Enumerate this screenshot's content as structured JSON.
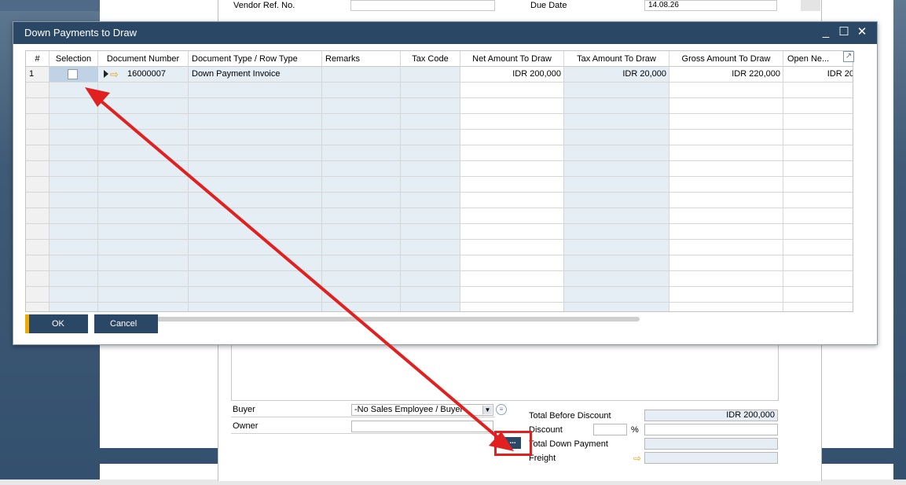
{
  "background_form": {
    "vendor_ref_label": "Vendor Ref. No.",
    "vendor_ref_value": "",
    "due_date_label": "Due Date",
    "due_date_value": "14.08.26",
    "buyer_label": "Buyer",
    "buyer_value": "-No Sales Employee / Buyer-",
    "owner_label": "Owner",
    "owner_value": "",
    "totals": {
      "total_before_discount_label": "Total Before Discount",
      "total_before_discount_value": "IDR 200,000",
      "discount_label": "Discount",
      "discount_pct_value": "",
      "discount_pct_unit": "%",
      "discount_value": "",
      "total_down_payment_label": "Total Down Payment",
      "total_down_payment_value": "",
      "freight_label": "Freight",
      "freight_value": "",
      "dots_button_label": "..."
    }
  },
  "dialog": {
    "title": "Down Payments to Draw",
    "minimize_symbol": "_",
    "maximize_symbol": "☐",
    "close_symbol": "✕",
    "columns": [
      "#",
      "Selection",
      "Document Number",
      "Document Type / Row Type",
      "Remarks",
      "Tax Code",
      "Net Amount To Draw",
      "Tax Amount To Draw",
      "Gross Amount To Draw",
      "Open Ne..."
    ],
    "rows": [
      {
        "num": "1",
        "selected": false,
        "document_number": "16000007",
        "document_type": "Down Payment Invoice",
        "remarks": "",
        "tax_code": "",
        "net_amount": "IDR 200,000",
        "tax_amount": "IDR 20,000",
        "gross_amount": "IDR 220,000",
        "open_net": "IDR 20"
      }
    ],
    "ok_label": "OK",
    "cancel_label": "Cancel"
  },
  "colors": {
    "title_bar": "#2b4766",
    "accent_ok": "#f0ab00",
    "annotation_red": "#e12020",
    "link_arrow": "#e8a417"
  },
  "icons": {
    "link_arrow": "⇨",
    "expand": "▶",
    "grid_expand": "↗",
    "info": "≡",
    "dropdown": "▼"
  }
}
